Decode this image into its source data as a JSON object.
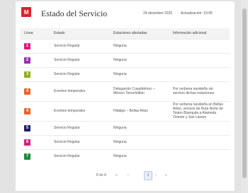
{
  "header": {
    "logo_text": "M",
    "title": "Estado del Servicio",
    "date": "24 diciembre 2025",
    "update": "Actualización: 19:06"
  },
  "table": {
    "columns": [
      "Línea",
      "Estado",
      "Estaciones afectadas",
      "Información adicional"
    ],
    "rows": [
      {
        "line": "1",
        "color": "#e0197d",
        "status": "Servicio Regular",
        "stations": "Ninguna",
        "info": ""
      },
      {
        "line": "2",
        "color": "#9b2db1",
        "status": "Servicio Regular",
        "stations": "Ninguna",
        "info": ""
      },
      {
        "line": "3",
        "color": "#8fae1b",
        "status": "Servicio Regular",
        "stations": "Ninguna",
        "info": ""
      },
      {
        "line": "4",
        "color": "#e8632b",
        "status": "Eventos temporales",
        "stations": "Delegación Cuauhtémoc – México Tenochtitlan",
        "info": "Por verbena navideña sin servicio dichas estaciones."
      },
      {
        "line": "4",
        "color": "#e8632b",
        "status": "Eventos temporales",
        "stations": "Hidalgo – Bellas Artes",
        "info": "Por verbena navideña en Bellas Artes, servicio de Ruta Norte de Teatro Blanquita a Alameda Oriente y San Lázaro"
      },
      {
        "line": "5",
        "color": "#1d1f6b",
        "status": "Servicio Regular",
        "stations": "Ninguna",
        "info": ""
      },
      {
        "line": "6",
        "color": "#e0197d",
        "status": "Servicio Regular",
        "stations": "Ninguna",
        "info": ""
      },
      {
        "line": "7",
        "color": "#1b8a3c",
        "status": "Servicio Regular",
        "stations": "Ninguna",
        "info": ""
      }
    ]
  },
  "pagination": {
    "range": "8 de 8",
    "first": "«",
    "prev": "‹",
    "current": "1",
    "next": "›",
    "last": "»"
  }
}
